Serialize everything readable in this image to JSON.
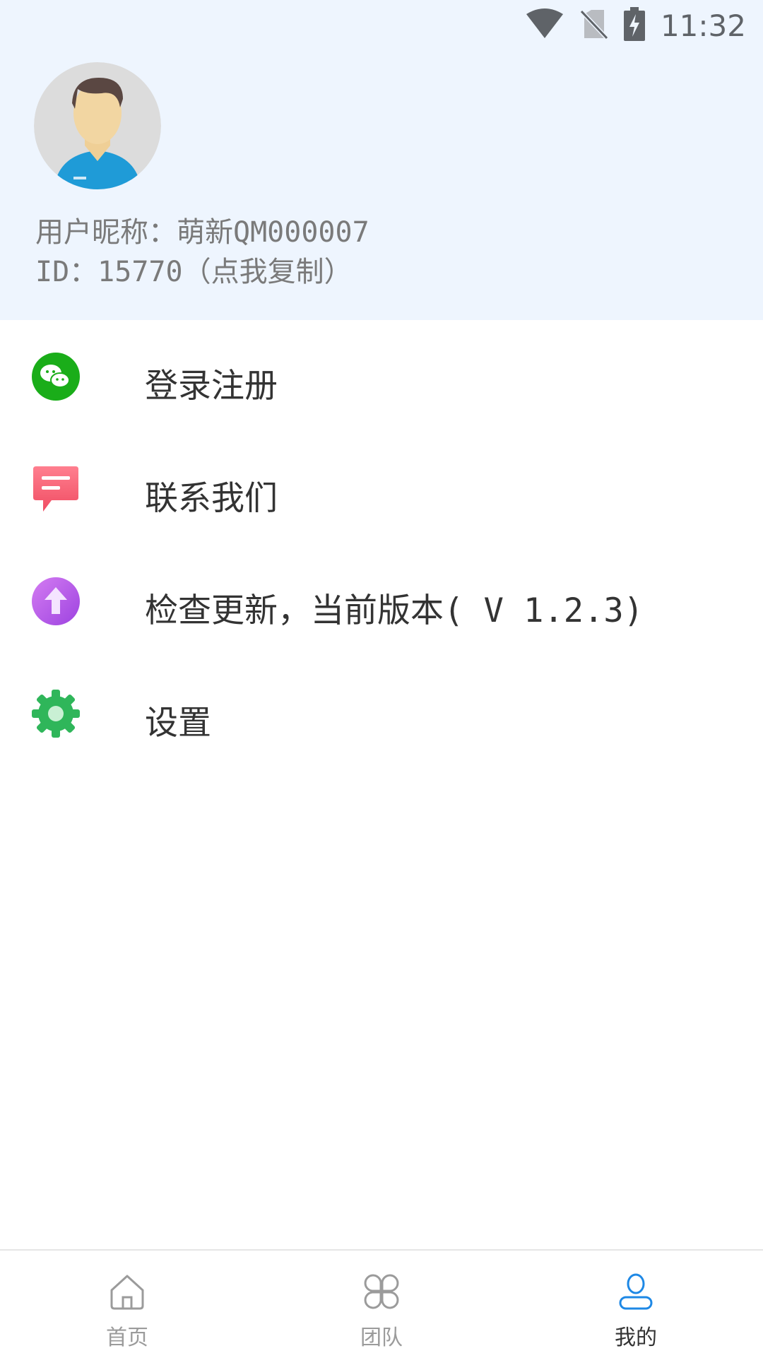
{
  "status_bar": {
    "time": "11:32",
    "icons": [
      "wifi-icon",
      "no-sim-icon",
      "battery-charging-icon"
    ]
  },
  "profile": {
    "avatar": "avatar-male-icon",
    "nickname": "用户昵称：萌新QM000007",
    "id_text": "ID：15770（点我复制）"
  },
  "menu": {
    "items": [
      {
        "label": "登录注册",
        "icon": "wechat-icon",
        "color": "#1aad19"
      },
      {
        "label": "联系我们",
        "icon": "message-icon",
        "color": "#f0566b"
      },
      {
        "label": "检查更新，当前版本( V 1.2.3)",
        "icon": "upload-arrow-icon",
        "color": "#b25ce8"
      },
      {
        "label": "设置",
        "icon": "gear-icon",
        "color": "#2fb65a"
      }
    ]
  },
  "tabbar": {
    "tabs": [
      {
        "label": "首页",
        "icon": "home-icon",
        "active": false
      },
      {
        "label": "团队",
        "icon": "team-grid-icon",
        "active": false
      },
      {
        "label": "我的",
        "icon": "user-icon",
        "active": true
      }
    ],
    "active_color": "#1e88e5"
  }
}
